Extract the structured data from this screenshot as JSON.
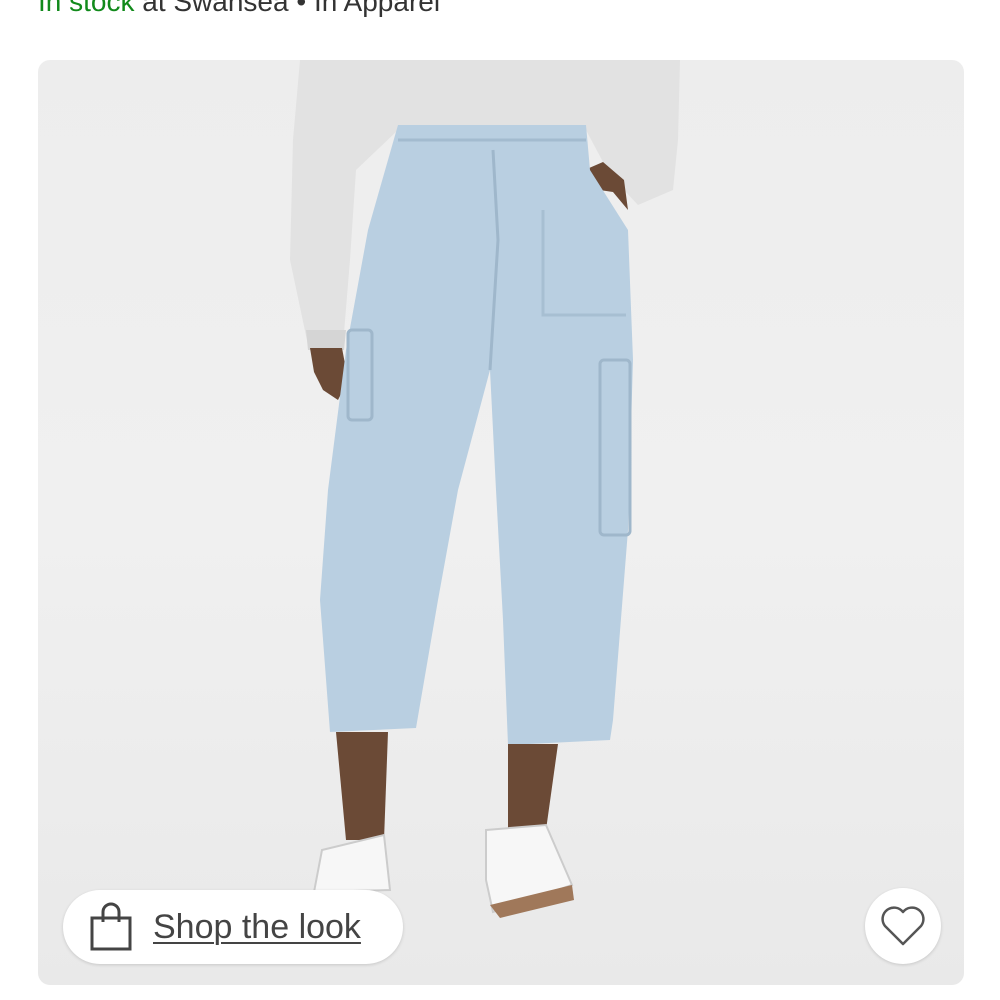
{
  "availability": {
    "status": "In stock",
    "location": " at Swansea",
    "separator": " • ",
    "category": "In Apparel"
  },
  "product_image": {
    "alt": "Light blue cargo pants worn with grey sweatshirt and white sneakers"
  },
  "actions": {
    "shop_the_look": "Shop the look",
    "favorite_icon": "heart-icon",
    "shop_icon": "shopping-bag-icon"
  },
  "colors": {
    "in_stock": "#118a1b",
    "pants": "#b9cfe1",
    "sweatshirt": "#e2e2e2"
  }
}
